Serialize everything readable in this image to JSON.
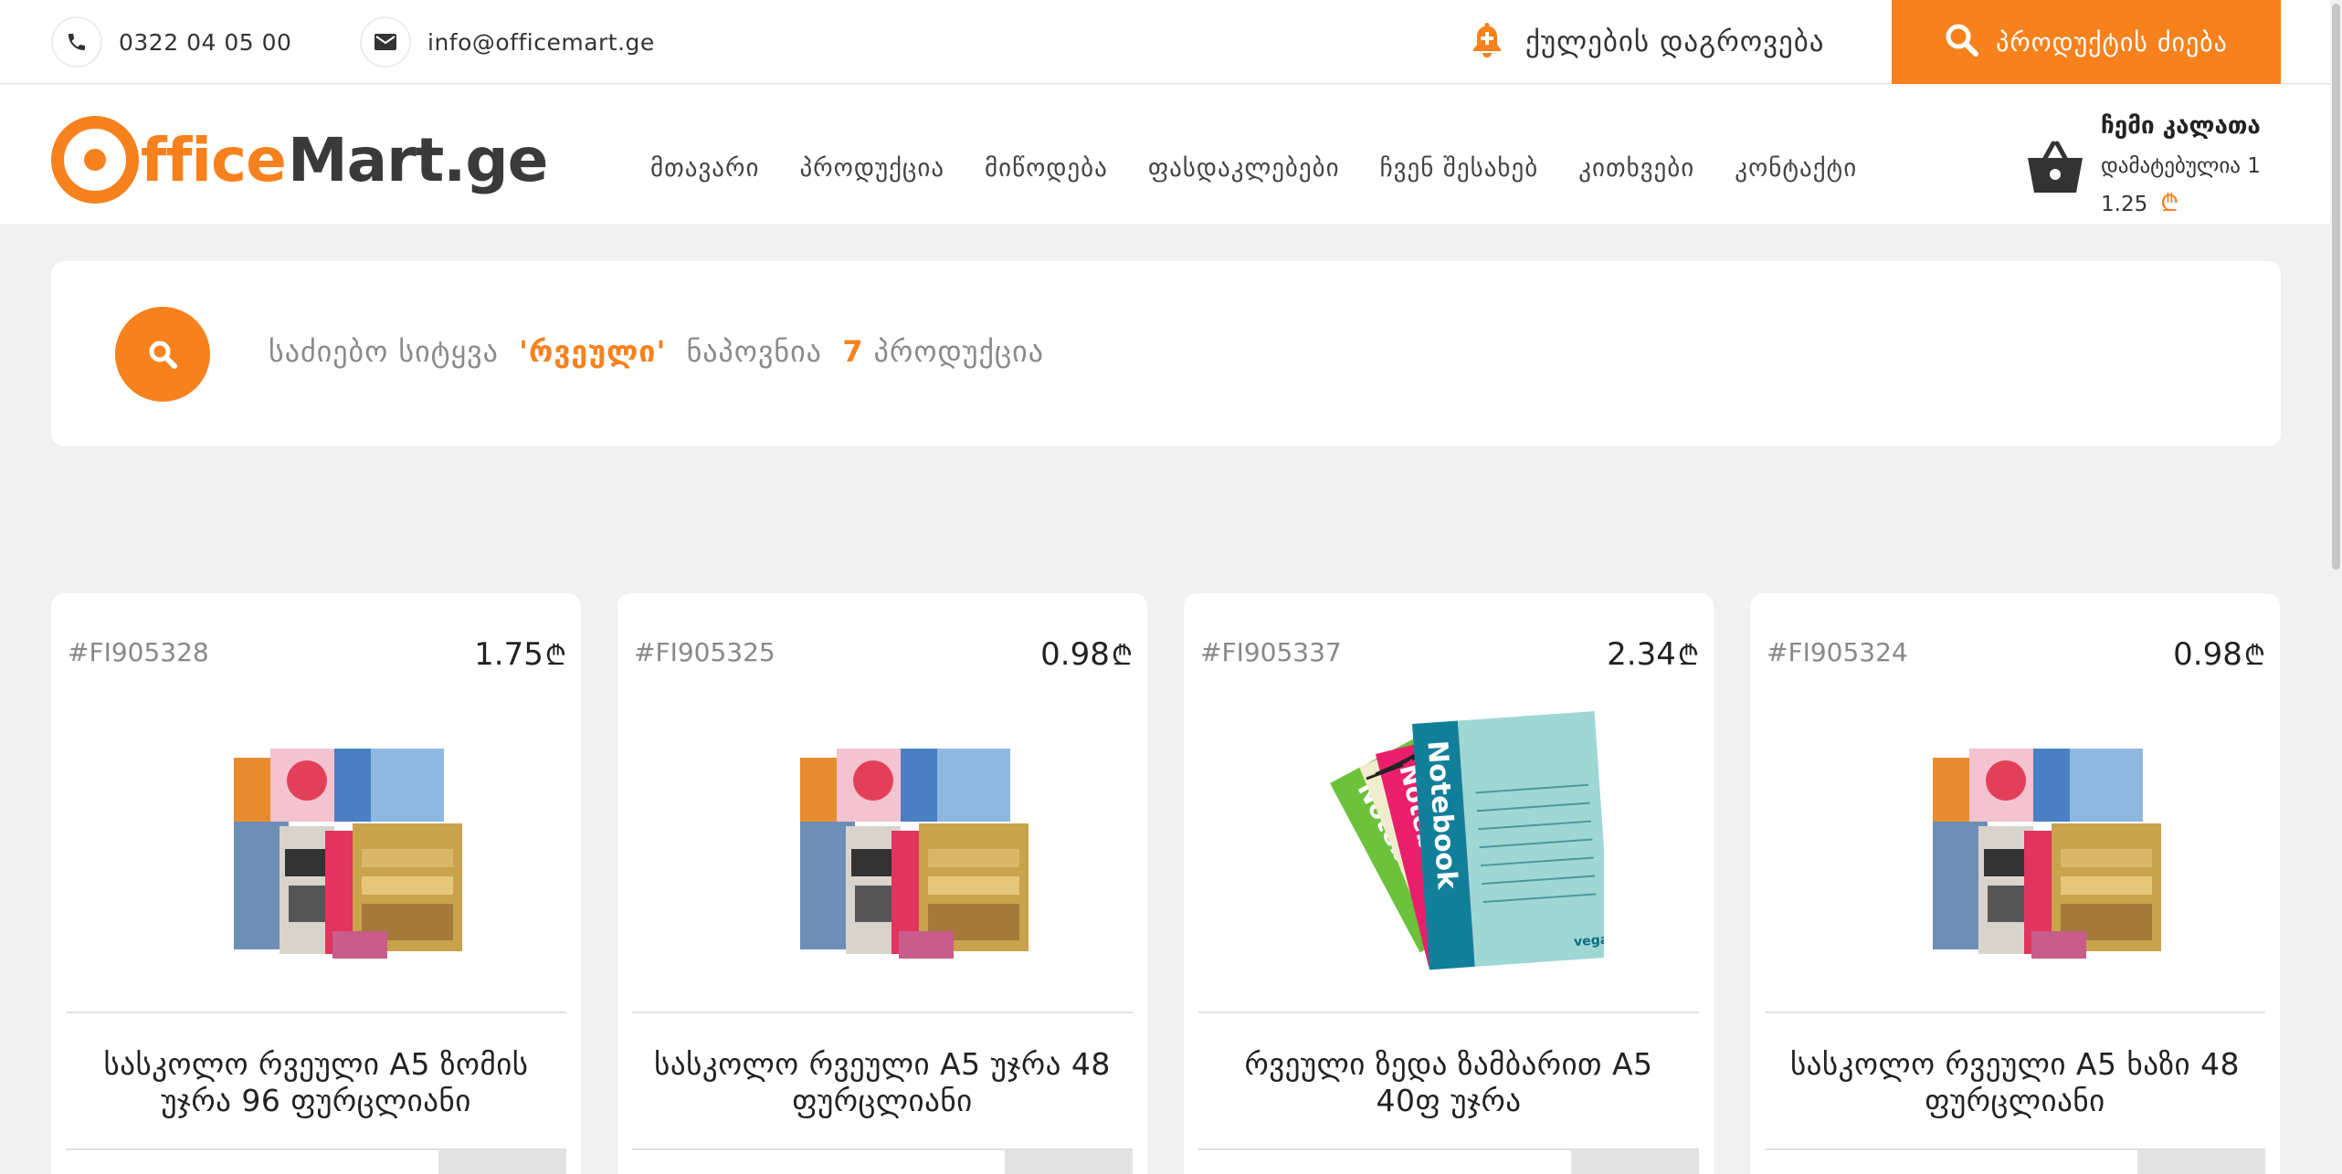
{
  "topbar": {
    "phone": "0322 04 05 00",
    "email": "info@officemart.ge",
    "notify_label": "ქულების დაგროვება",
    "search_label": "პროდუქტის ძიება"
  },
  "logo": {
    "part1": "ffice",
    "part2": "Mart.ge"
  },
  "nav": [
    {
      "label": "მთავარი"
    },
    {
      "label": "პროდუქცია"
    },
    {
      "label": "მიწოდება"
    },
    {
      "label": "ფასდაკლებები"
    },
    {
      "label": "ჩვენ შესახებ"
    },
    {
      "label": "კითხვები"
    },
    {
      "label": "კონტაქტი"
    }
  ],
  "cart": {
    "title": "ჩემი კალათა",
    "added": "დამატებულია 1",
    "total": "1.25",
    "currency": "₾"
  },
  "search_result": {
    "prefix": "საძიებო სიტყვა",
    "keyword": "'რვეული'",
    "middle": "ნაპოვნია",
    "count": "7",
    "suffix": "პროდუქცია"
  },
  "products": [
    {
      "code": "#FI905328",
      "price": "1.75",
      "currency": "₾",
      "name": "სასკოლო რვეული A5 ზომის უჯრა 96 ფურცლიანი",
      "image": "notebook-stack"
    },
    {
      "code": "#FI905325",
      "price": "0.98",
      "currency": "₾",
      "name": "სასკოლო რვეული A5 უჯრა 48 ფურცლიანი",
      "image": "notebook-stack"
    },
    {
      "code": "#FI905337",
      "price": "2.34",
      "currency": "₾",
      "name": "რვეული ზედა ზამბარით A5 40ფ უჯრა",
      "image": "spiral-notebooks",
      "image_texts": [
        "Notebook",
        "Notebook",
        "Notebook",
        "vega"
      ]
    },
    {
      "code": "#FI905324",
      "price": "0.98",
      "currency": "₾",
      "name": "სასკოლო რვეული A5 ხაზი 48 ფურცლიანი",
      "image": "notebook-stack"
    }
  ],
  "colors": {
    "accent": "#f7811d",
    "text": "#333333",
    "muted": "#8a8a8a",
    "background": "#f1f1f1"
  }
}
